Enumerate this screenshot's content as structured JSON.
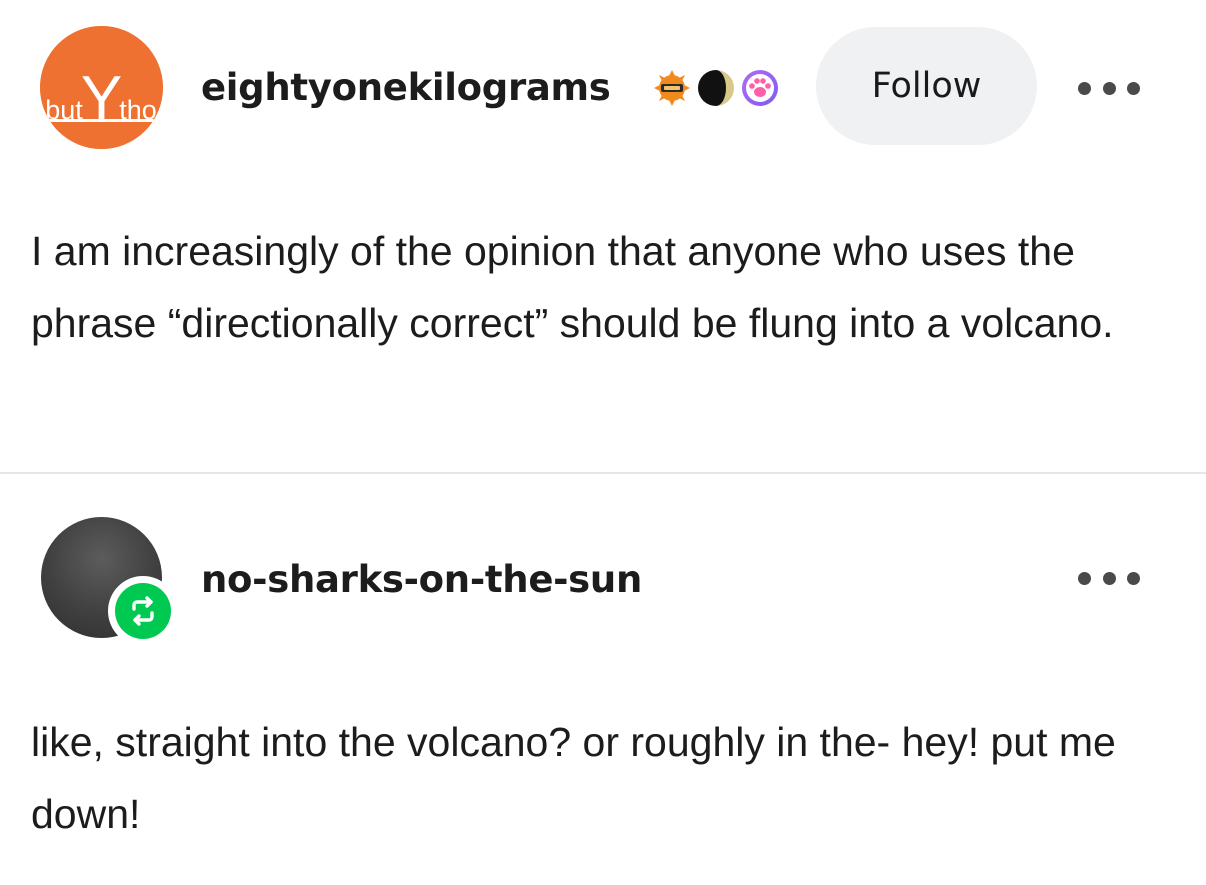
{
  "posts": [
    {
      "username": "eightyonekilograms",
      "avatar_text": {
        "left": "but",
        "mark": "Y",
        "right": "tho"
      },
      "avatar_color": "#ee7131",
      "badges": [
        "fez-badge-icon",
        "moon-phase-icon",
        "paw-print-icon"
      ],
      "follow_label": "Follow",
      "more_icon": "ellipsis-icon",
      "text": "I am increasingly of the opinion that anyone who uses the phrase “directionally correct” should be flung into a volcano."
    },
    {
      "username": "no-sharks-on-the-sun",
      "reblog_icon": "reblog-icon",
      "reblog_color": "#00c951",
      "more_icon": "ellipsis-icon",
      "text": "like, straight into the volcano? or roughly in the- hey! put me down!"
    }
  ]
}
